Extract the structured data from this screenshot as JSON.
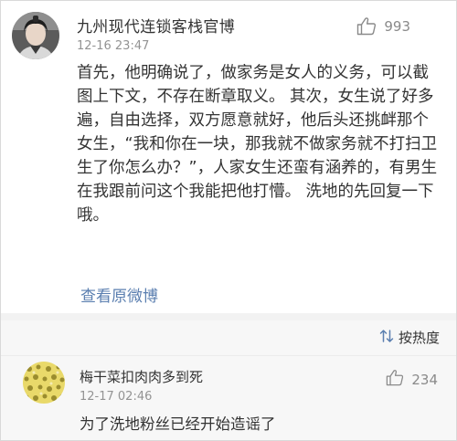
{
  "post": {
    "username": "九州现代连锁客栈官博",
    "timestamp": "12-16 23:47",
    "like_count": "993",
    "body": "首先，他明确说了，做家务是女人的义务，可以截图上下文，不存在断章取义。 其次，女生说了好多遍，自由选择，双方愿意就好，他后头还挑衅那个女生，“我和你在一块，那我就不做家务就不打扫卫生了你怎么办？”，人家女生还蛮有涵养的，有男生在我跟前问这个我能把他打懵。 洗地的先回复一下哦。",
    "view_original_label": "查看原微博",
    "like_icon": "thumbs-up-icon"
  },
  "sort_bar": {
    "label": "按热度",
    "icon": "sort-arrows-icon"
  },
  "comments": [
    {
      "username": "梅干菜扣肉肉多到死",
      "timestamp": "12-17 02:46",
      "like_count": "234",
      "text": "为了洗地粉丝已经开始造谣了"
    }
  ],
  "colors": {
    "link": "#5b7fb0",
    "text": "#333333",
    "muted": "#939393",
    "panel_bg": "#f7f7f7"
  }
}
